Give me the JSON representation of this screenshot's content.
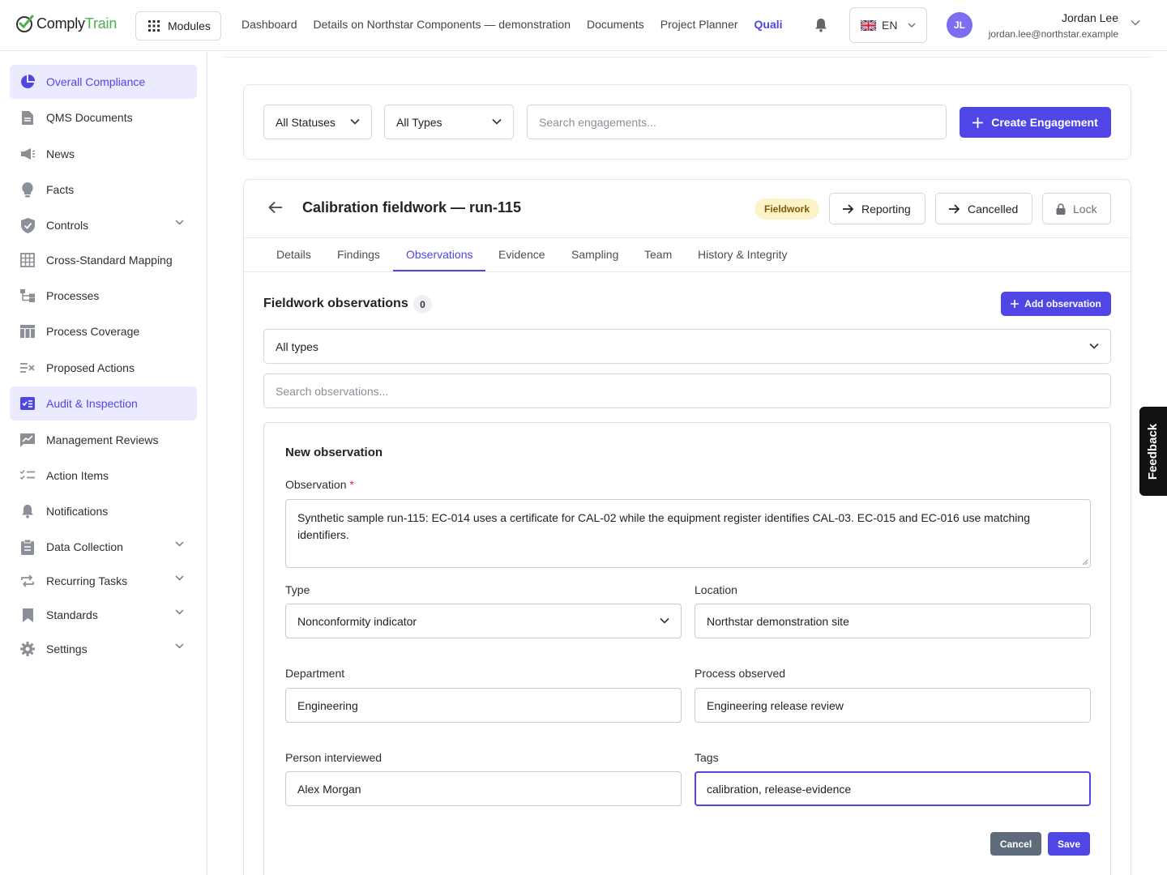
{
  "app": {
    "logo_part1": "Comply",
    "logo_part2": "Train",
    "brand_green": "#4caf50",
    "accent": "#4f46e5"
  },
  "header": {
    "modules_label": "Modules",
    "nav": [
      "Dashboard",
      "Details on Northstar Components — demonstration",
      "Documents",
      "Project Planner",
      "Quali"
    ],
    "language": "EN",
    "user": {
      "initials": "JL",
      "name": "Jordan Lee",
      "email": "jordan.lee@northstar.example"
    }
  },
  "sidebar": {
    "items": [
      {
        "label": "Overall Compliance",
        "icon": "pie-chart-icon",
        "active": true
      },
      {
        "label": "QMS Documents",
        "icon": "document-icon"
      },
      {
        "label": "News",
        "icon": "megaphone-icon"
      },
      {
        "label": "Facts",
        "icon": "lightbulb-icon"
      },
      {
        "label": "Controls",
        "icon": "shield-icon",
        "expandable": true
      },
      {
        "label": "Cross-Standard Mapping",
        "icon": "grid-icon"
      },
      {
        "label": "Processes",
        "icon": "flow-icon"
      },
      {
        "label": "Process Coverage",
        "icon": "table-icon"
      },
      {
        "label": "Proposed Actions",
        "icon": "list-x-icon"
      },
      {
        "label": "Audit & Inspection",
        "icon": "checklist-board-icon",
        "active": true
      },
      {
        "label": "Management Reviews",
        "icon": "chart-board-icon"
      },
      {
        "label": "Action Items",
        "icon": "checklist-icon"
      },
      {
        "label": "Notifications",
        "icon": "bell-icon"
      },
      {
        "label": "Data Collection",
        "icon": "clipboard-icon",
        "expandable": true
      },
      {
        "label": "Recurring Tasks",
        "icon": "repeat-icon",
        "expandable": true
      },
      {
        "label": "Standards",
        "icon": "bookmark-icon",
        "expandable": true
      },
      {
        "label": "Settings",
        "icon": "gear-icon",
        "expandable": true
      }
    ]
  },
  "filters": {
    "status": "All Statuses",
    "type": "All Types",
    "search_placeholder": "Search engagements...",
    "create_label": "Create Engagement"
  },
  "engagement": {
    "title": "Calibration fieldwork — run-115",
    "status_badge": "Fieldwork",
    "actions": [
      "Reporting",
      "Cancelled",
      "Lock"
    ],
    "tabs": [
      "Details",
      "Findings",
      "Observations",
      "Evidence",
      "Sampling",
      "Team",
      "History & Integrity"
    ],
    "active_tab": "Observations"
  },
  "observations": {
    "title": "Fieldwork observations",
    "count": "0",
    "add_label": "Add observation",
    "type_filter": "All types",
    "search_placeholder": "Search observations..."
  },
  "form": {
    "heading": "New observation",
    "observation_label": "Observation",
    "required_mark": "*",
    "observation_value": "Synthetic sample run-115: EC-014 uses a certificate for CAL-02 while the equipment register identifies CAL-03. EC-015 and EC-016 use matching identifiers.",
    "type_label": "Type",
    "type_value": "Nonconformity indicator",
    "location_label": "Location",
    "location_value": "Northstar demonstration site",
    "department_label": "Department",
    "department_value": "Engineering",
    "process_label": "Process observed",
    "process_value": "Engineering release review",
    "person_label": "Person interviewed",
    "person_value": "Alex Morgan",
    "tags_label": "Tags",
    "tags_value": "calibration, release-evidence",
    "cancel_label": "Cancel",
    "save_label": "Save"
  },
  "feedback_label": "Feedback"
}
